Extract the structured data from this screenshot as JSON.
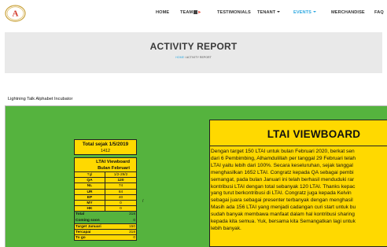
{
  "nav": {
    "logo_text": "A",
    "items": [
      "HOME",
      "TEAM",
      "TESTIMONIALS",
      "TENANT",
      "EVENTS",
      "MERCHANDISE",
      "FAQ"
    ]
  },
  "banner": {
    "title": "ACTIVITY REPORT",
    "breadcrumb_home": "HOME",
    "breadcrumb_rest": " / ACTIVITY REPORT"
  },
  "frame": {
    "title": "Lightning Talk Alphabet Incubator"
  },
  "total_box": {
    "label": "Total sejak 1/5/2019",
    "value": "1412"
  },
  "viewboard_table": {
    "title_line1": "LTAI Viewboard",
    "title_line2": "Bulan Februari",
    "header": [
      "Tgl",
      "1/2-29/2"
    ],
    "rows": [
      [
        "QA",
        "120"
      ],
      [
        "NL",
        "74"
      ],
      [
        "UR",
        "84"
      ],
      [
        "EP",
        "40"
      ],
      [
        "MY",
        "0"
      ],
      [
        "HK",
        "0"
      ]
    ],
    "summary": [
      [
        "Total",
        "318"
      ],
      [
        "Coming soon",
        "0"
      ],
      [
        "Target Januari",
        "150"
      ],
      [
        "Tercapai",
        "318"
      ],
      [
        "To go",
        "0"
      ]
    ],
    "stray_mark": "/"
  },
  "panel": {
    "title": "LTAI VIEWBOARD",
    "lines": [
      "Dengan target 150 LTAI untuk bulan Februari 2020, berkat sen",
      "dari 6 Pembimbing, Alhamdulillah per tanggal 29 Februari telah",
      "LTAI yaitu lebih dari 100%. Secara keseluruhan, sejak tanggal",
      "menghasilkan 1652 LTAI. Congratz kepada QA sebagai pembi",
      "semangat, pada bulan Januari ini telah berhasil menduduki rar",
      "kontribusi LTAI dengan total sebanyak 120 LTAI. Thanks kepac",
      "yang turut berkontribusi di LTAI. Congratz juga kepada Kelvin",
      "sebagai juara sebagai presenter terbanyak dengan menghasil",
      "Masih ada 156 LTAI yang menjadi cadangan curi start untuk bu",
      "sudah banyak membawa manfaat dalam hal kontribusi sharing",
      "kepada kita semua. Yuk, bersama kita Semangatkan lagi untuk",
      "lebih banyak."
    ]
  },
  "colors": {
    "accent": "#2ea8e0",
    "frame_green": "#55b33e",
    "board_yellow": "#ffd900",
    "banner_gray": "#e9e9e9"
  }
}
